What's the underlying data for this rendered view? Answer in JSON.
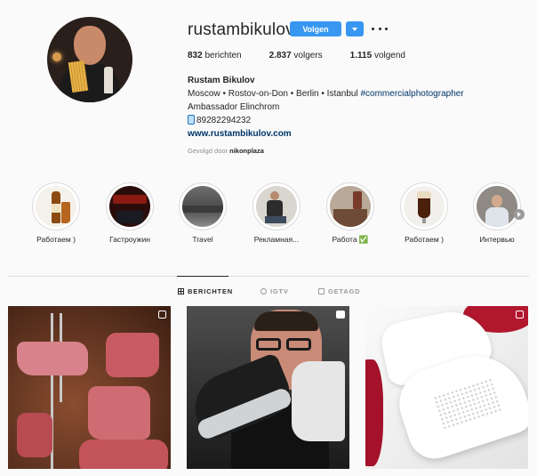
{
  "profile": {
    "username": "rustambikulov",
    "follow_label": "Volgen",
    "posts_count": "832",
    "posts_label": "berichten",
    "followers_count": "2.837",
    "followers_label": "volgers",
    "following_count": "1.115",
    "following_label": "volgend",
    "full_name": "Rustam Bikulov",
    "bio_line1": "Moscow • Rostov-on-Don • Berlin • Istanbul ",
    "bio_hashtag": "#commercialphotographer",
    "bio_line2": "Ambassador Elinchrom",
    "phone": "89282294232",
    "website": "www.rustambikulov.com",
    "followed_by_prefix": "Gevolgd door ",
    "followed_by_user": "nikonplaza"
  },
  "highlights": [
    {
      "label": "Работаем )",
      "icon": "beer-bottle"
    },
    {
      "label": "Гастроужин",
      "icon": "restaurant-sign"
    },
    {
      "label": "Travel",
      "icon": "landscape"
    },
    {
      "label": "Рекламная...",
      "icon": "person-sitting"
    },
    {
      "label": "Работа ✅",
      "icon": "kitchen-scene"
    },
    {
      "label": "Работаем )",
      "icon": "beer-glass"
    },
    {
      "label": "Интервью",
      "icon": "person-portrait"
    }
  ],
  "tabs": [
    {
      "label": "BERICHTEN",
      "icon": "grid-icon",
      "active": true
    },
    {
      "label": "IGTV",
      "icon": "tv-icon",
      "active": false
    },
    {
      "label": "GETAGD",
      "icon": "tag-icon",
      "active": false
    }
  ],
  "posts": [
    {
      "subject": "raw meat on fork",
      "badge": "multiple-photos-icon"
    },
    {
      "subject": "man holding sneakers",
      "badge": "video-icon"
    },
    {
      "subject": "white perforated sneakers with roses",
      "badge": "multiple-photos-icon"
    }
  ],
  "colors": {
    "accent": "#3897f0",
    "link": "#003569",
    "muted": "#8e8e8e",
    "text": "#262626"
  }
}
